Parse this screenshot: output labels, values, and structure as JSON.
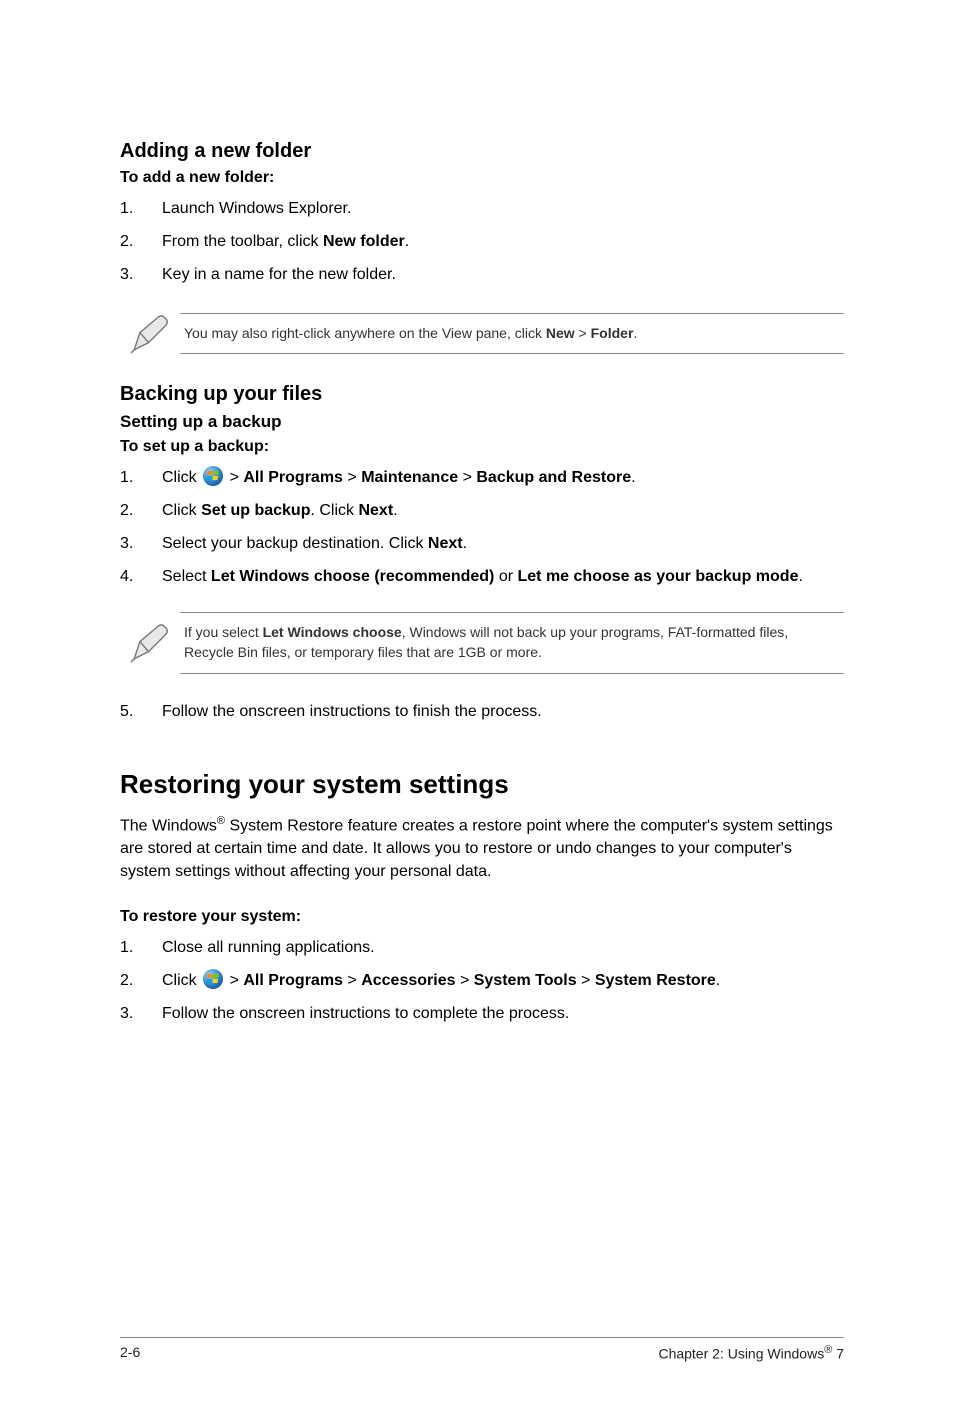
{
  "section_add": {
    "heading": "Adding a new folder",
    "sub": "To add a new folder:",
    "steps": [
      "Launch Windows Explorer.",
      {
        "pre": "From the toolbar, click ",
        "bold": "New folder",
        "post": "."
      },
      "Key in a name for the new folder."
    ],
    "note": {
      "pre": "You may also right-click anywhere on the View pane, click ",
      "b1": "New",
      "mid": " > ",
      "b2": "Folder",
      "post": "."
    }
  },
  "section_backup": {
    "heading": "Backing up your files",
    "sub_heading": "Setting up a backup",
    "sub": "To set up a backup:",
    "step1": {
      "pre": "Click ",
      "b1": "All Programs",
      "b2": "Maintenance",
      "b3": "Backup and Restore"
    },
    "step2": {
      "pre": "Click ",
      "b1": "Set up backup",
      "mid": ". Click ",
      "b2": "Next",
      "post": "."
    },
    "step3": {
      "pre": "Select your backup destination. Click ",
      "b1": "Next",
      "post": "."
    },
    "step4": {
      "pre": "Select ",
      "b1": "Let Windows choose (recommended)",
      "mid": " or ",
      "b2": "Let me choose as your backup mode",
      "post": "."
    },
    "note": {
      "pre": "If you select ",
      "b1": "Let Windows choose",
      "post": ", Windows will not back up your programs, FAT-formatted files, Recycle Bin files, or temporary files that are 1GB or more."
    },
    "step5": "Follow the onscreen instructions to finish the process."
  },
  "section_restore": {
    "heading": "Restoring your system settings",
    "para_pre": "The Windows",
    "para_post": " System Restore feature creates a restore point where the computer's system settings are stored at certain time and date. It allows you to restore or undo changes to your computer's system settings without affecting your personal data.",
    "sub": "To restore your system:",
    "step1": "Close all running applications.",
    "step2": {
      "pre": "Click ",
      "b1": "All Programs",
      "b2": "Accessories",
      "b3": "System Tools",
      "b4": "System Restore"
    },
    "step3": "Follow the onscreen instructions to complete the process."
  },
  "footer": {
    "left": "2-6",
    "right_pre": "Chapter 2: Using Windows",
    "right_post": " 7"
  },
  "glyphs": {
    "gt": ">",
    "reg": "®"
  }
}
